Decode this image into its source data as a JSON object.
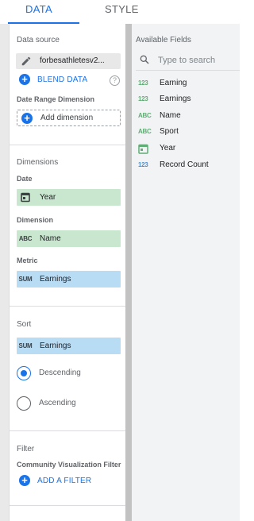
{
  "tabs": {
    "data": "DATA",
    "style": "STYLE"
  },
  "datasource": {
    "section_label": "Data source",
    "name": "forbesathletesv2...",
    "blend_label": "BLEND DATA"
  },
  "date_range": {
    "label": "Date Range Dimension",
    "add_label": "Add dimension"
  },
  "dimensions": {
    "section_label": "Dimensions",
    "date_label": "Date",
    "date_chip": {
      "type": "date",
      "label": "Year"
    },
    "dimension_label": "Dimension",
    "dimension_chip": {
      "type": "ABC",
      "label": "Name"
    },
    "metric_label": "Metric",
    "metric_chip": {
      "type": "SUM",
      "label": "Earnings"
    }
  },
  "sort": {
    "section_label": "Sort",
    "chip": {
      "type": "SUM",
      "label": "Earnings"
    },
    "options": [
      {
        "label": "Descending",
        "selected": true
      },
      {
        "label": "Ascending",
        "selected": false
      }
    ]
  },
  "filter": {
    "section_label": "Filter",
    "sub_label": "Community Visualization Filter",
    "add_label": "ADD A FILTER"
  },
  "available_fields": {
    "title": "Available Fields",
    "search_placeholder": "Type to search",
    "fields": [
      {
        "type": "123",
        "label": "Earning",
        "icon_color": "#5fae74"
      },
      {
        "type": "123",
        "label": "Earnings",
        "icon_color": "#5fae74"
      },
      {
        "type": "ABC",
        "label": "Name",
        "icon_color": "#5fae74"
      },
      {
        "type": "ABC",
        "label": "Sport",
        "icon_color": "#5fae74"
      },
      {
        "type": "calendar",
        "label": "Year",
        "icon_color": "#5fae74"
      },
      {
        "type": "123",
        "label": "Record Count",
        "icon_color": "#4a8fd8"
      }
    ]
  },
  "colors": {
    "accent": "#1a73e8",
    "dimension_chip": "#c9e7cf",
    "metric_chip": "#b9dcf5"
  }
}
